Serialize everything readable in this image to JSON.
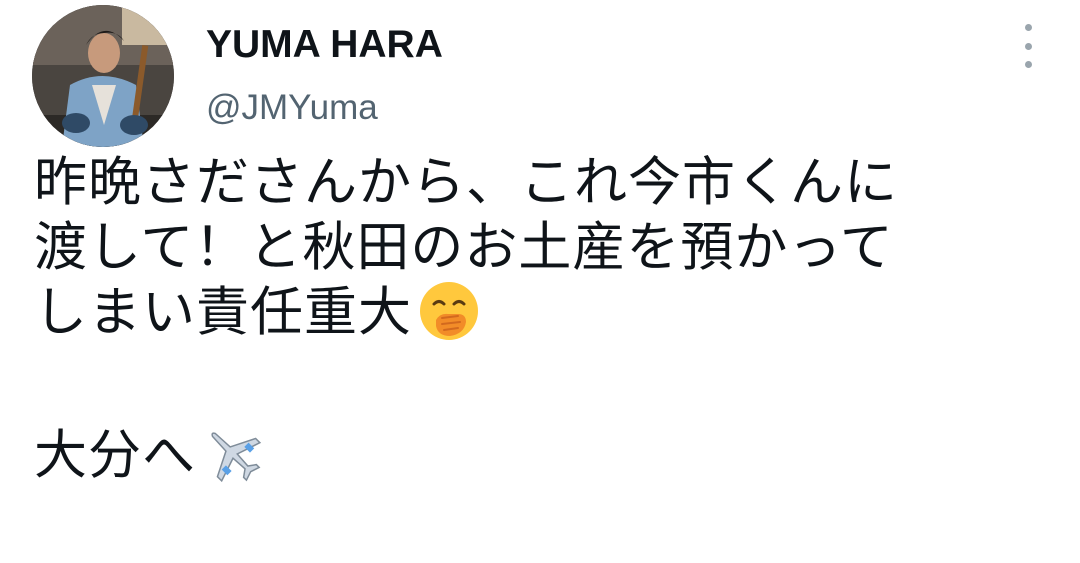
{
  "tweet": {
    "display_name": "YUMA HARA",
    "handle": "@JMYuma",
    "more_icon": "vertical-dots-icon",
    "text_lines": [
      "昨晩さださんから、これ今市くんに",
      "渡して！と秋田のお土産を預かって",
      "しまい責任重大"
    ],
    "last_line": "大分へ",
    "emojis": [
      "face-with-hand-over-mouth",
      "airplane"
    ]
  },
  "colors": {
    "text": "#0f1419",
    "secondary": "#536471",
    "dots": "#9aa5ad"
  }
}
